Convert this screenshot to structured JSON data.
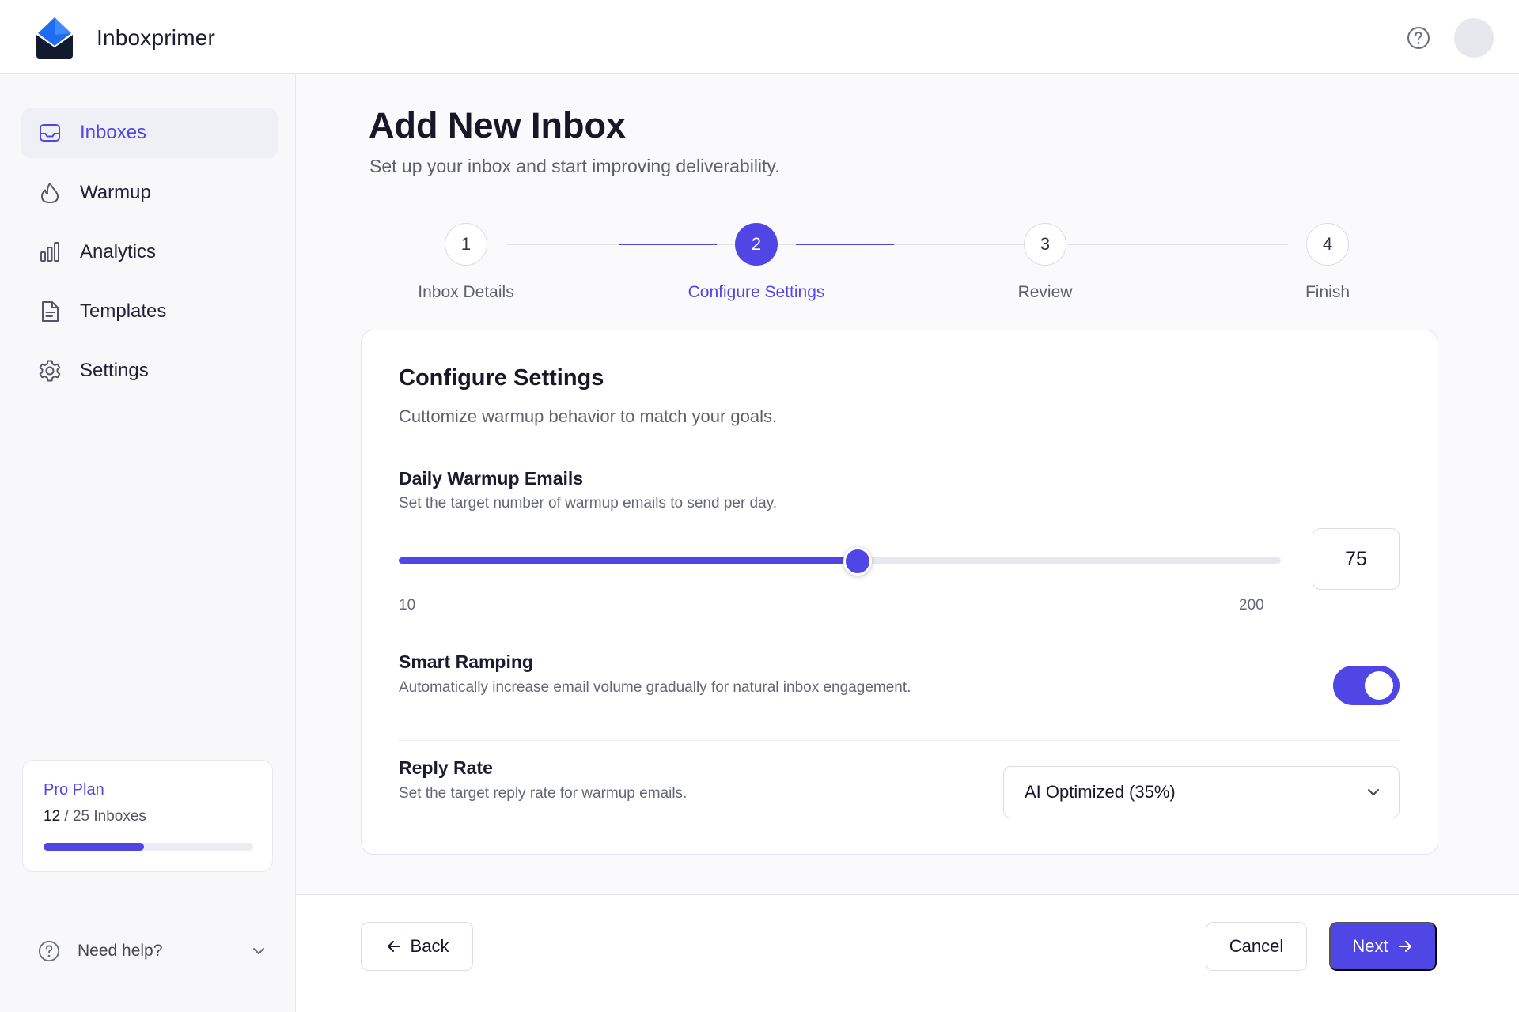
{
  "app": {
    "name": "Inboxprimer",
    "brand_color": "#4f46e5"
  },
  "header": {
    "help_icon": "help-circle-icon",
    "avatar": "user-avatar"
  },
  "sidebar": {
    "items": [
      {
        "label": "Inboxes",
        "icon": "inbox-icon",
        "active": true
      },
      {
        "label": "Warmup",
        "icon": "flame-icon",
        "active": false
      },
      {
        "label": "Analytics",
        "icon": "bar-chart-icon",
        "active": false
      },
      {
        "label": "Templates",
        "icon": "document-icon",
        "active": false
      },
      {
        "label": "Settings",
        "icon": "gear-icon",
        "active": false
      }
    ],
    "plan": {
      "name": "Pro Plan",
      "used": "12",
      "usage_rest": " / 25 Inboxes",
      "usage_fraction": 0.48
    },
    "need_help": "Need help?"
  },
  "page": {
    "title": "Add New Inbox",
    "subtitle": "Set up your inbox and start improving deliverability."
  },
  "stepper": {
    "current": 2,
    "steps": [
      {
        "number": "1",
        "label": "Inbox Details"
      },
      {
        "number": "2",
        "label": "Configure Settings"
      },
      {
        "number": "3",
        "label": "Review"
      },
      {
        "number": "4",
        "label": "Finish"
      }
    ]
  },
  "card": {
    "title": "Configure Settings",
    "subtitle": "Cuttomize warmup behavior to match your goals.",
    "daily_warmup": {
      "title": "Daily Warmup Emails",
      "description": "Set the target number of warmup emails to send per day.",
      "min": "10",
      "max": "200",
      "value": "75",
      "slider_fraction": 0.52
    },
    "smart_ramping": {
      "title": "Smart Ramping",
      "description": "Automatically increase email volume gradually for natural inbox engagement.",
      "enabled": true
    },
    "reply_rate": {
      "title": "Reply Rate",
      "description": "Set the target reply rate for warmup emails.",
      "selected": "AI Optimized (35%)"
    }
  },
  "footer": {
    "back_label": "Back",
    "cancel_label": "Cancel",
    "next_label": "Next"
  }
}
